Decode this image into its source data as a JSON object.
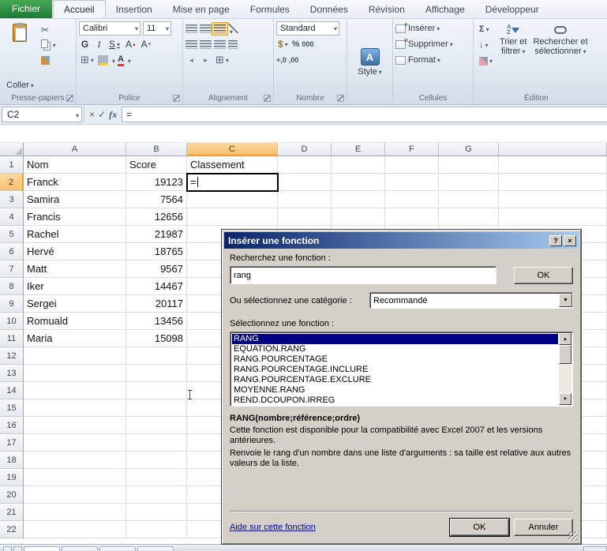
{
  "ribbon": {
    "tabs": [
      {
        "label": "Fichier",
        "file": true
      },
      {
        "label": "Accueil",
        "active": true
      },
      {
        "label": "Insertion"
      },
      {
        "label": "Mise en page"
      },
      {
        "label": "Formules"
      },
      {
        "label": "Données"
      },
      {
        "label": "Révision"
      },
      {
        "label": "Affichage"
      },
      {
        "label": "Développeur"
      }
    ],
    "clipboard": {
      "label": "Presse-papiers",
      "paste": "Coller"
    },
    "font": {
      "label": "Police",
      "name": "Calibri",
      "size": "11",
      "bold": "G",
      "italic": "I",
      "underline": "S",
      "grow": "A",
      "shrink": "A",
      "color": "A"
    },
    "alignment": {
      "label": "Alignement"
    },
    "number": {
      "label": "Nombre",
      "format": "Standard",
      "percent": "%",
      "thousands": "000",
      "dec_inc": "+,0",
      "dec_dec": ",00"
    },
    "style": {
      "button": "Style",
      "icon_letter": "A"
    },
    "cells": {
      "label": "Cellules",
      "insert": "Insérer",
      "delete": "Supprimer",
      "format": "Format"
    },
    "editing": {
      "label": "Édition",
      "sum": "Σ",
      "sort_line1": "Trier et",
      "sort_line2": "filtrer",
      "find_line1": "Rechercher et",
      "find_line2": "sélectionner"
    }
  },
  "formula_bar": {
    "name_box": "C2",
    "cancel": "×",
    "enter": "✓",
    "fx": "fx",
    "formula": "="
  },
  "grid": {
    "columns": [
      "A",
      "B",
      "C",
      "D",
      "E",
      "F",
      "G"
    ],
    "selection": {
      "cell": "C2",
      "col": "C",
      "row": 2
    },
    "rows": [
      {
        "n": 1,
        "cells": [
          "Nom",
          "Score",
          "Classement",
          "",
          "",
          "",
          ""
        ]
      },
      {
        "n": 2,
        "cells": [
          "Franck",
          "19123",
          "=",
          "",
          "",
          "",
          ""
        ]
      },
      {
        "n": 3,
        "cells": [
          "Samira",
          "7564",
          "",
          "",
          "",
          "",
          ""
        ]
      },
      {
        "n": 4,
        "cells": [
          "Francis",
          "12656",
          "",
          "",
          "",
          "",
          ""
        ]
      },
      {
        "n": 5,
        "cells": [
          "Rachel",
          "21987",
          "",
          "",
          "",
          "",
          ""
        ]
      },
      {
        "n": 6,
        "cells": [
          "Hervé",
          "18765",
          "",
          "",
          "",
          "",
          ""
        ]
      },
      {
        "n": 7,
        "cells": [
          "Matt",
          "9567",
          "",
          "",
          "",
          "",
          ""
        ]
      },
      {
        "n": 8,
        "cells": [
          "Iker",
          "14467",
          "",
          "",
          "",
          "",
          ""
        ]
      },
      {
        "n": 9,
        "cells": [
          "Sergei",
          "20117",
          "",
          "",
          "",
          "",
          ""
        ]
      },
      {
        "n": 10,
        "cells": [
          "Romuald",
          "13456",
          "",
          "",
          "",
          "",
          ""
        ]
      },
      {
        "n": 11,
        "cells": [
          "Maria",
          "15098",
          "",
          "",
          "",
          "",
          ""
        ]
      },
      {
        "n": 12,
        "cells": [
          "",
          "",
          "",
          "",
          "",
          "",
          ""
        ]
      },
      {
        "n": 13,
        "cells": [
          "",
          "",
          "",
          "",
          "",
          "",
          ""
        ]
      },
      {
        "n": 14,
        "cells": [
          "",
          "",
          "",
          "",
          "",
          "",
          ""
        ]
      },
      {
        "n": 15,
        "cells": [
          "",
          "",
          "",
          "",
          "",
          "",
          ""
        ]
      },
      {
        "n": 16,
        "cells": [
          "",
          "",
          "",
          "",
          "",
          "",
          ""
        ]
      },
      {
        "n": 17,
        "cells": [
          "",
          "",
          "",
          "",
          "",
          "",
          ""
        ]
      },
      {
        "n": 18,
        "cells": [
          "",
          "",
          "",
          "",
          "",
          "",
          ""
        ]
      },
      {
        "n": 19,
        "cells": [
          "",
          "",
          "",
          "",
          "",
          "",
          ""
        ]
      },
      {
        "n": 20,
        "cells": [
          "",
          "",
          "",
          "",
          "",
          "",
          ""
        ]
      },
      {
        "n": 21,
        "cells": [
          "",
          "",
          "",
          "",
          "",
          "",
          ""
        ]
      },
      {
        "n": 22,
        "cells": [
          "",
          "",
          "",
          "",
          "",
          "",
          ""
        ]
      }
    ]
  },
  "dialog": {
    "title": "Insérer une fonction",
    "help_button": "?",
    "close_button": "×",
    "search_label": "Recherchez une fonction :",
    "search_value": "rang",
    "ok_search": "OK",
    "category_label": "Ou sélectionnez une catégorie :",
    "category_value": "Recommandé",
    "function_label": "Sélectionnez une fonction :",
    "functions": [
      "RANG",
      "EQUATION.RANG",
      "RANG.POURCENTAGE",
      "RANG.POURCENTAGE.INCLURE",
      "RANG.POURCENTAGE.EXCLURE",
      "MOYENNE.RANG",
      "REND.DCOUPON.IRREG"
    ],
    "selected_function": "RANG",
    "signature": "RANG(nombre;référence;ordre)",
    "description": [
      "Cette fonction est disponible pour la compatibilité avec Excel 2007 et les versions antérieures.",
      "Renvoie le rang d'un nombre dans une liste d'arguments : sa taille est relative aux autres valeurs de la liste."
    ],
    "help_link": "Aide sur cette fonction",
    "ok": "OK",
    "cancel": "Annuler"
  }
}
